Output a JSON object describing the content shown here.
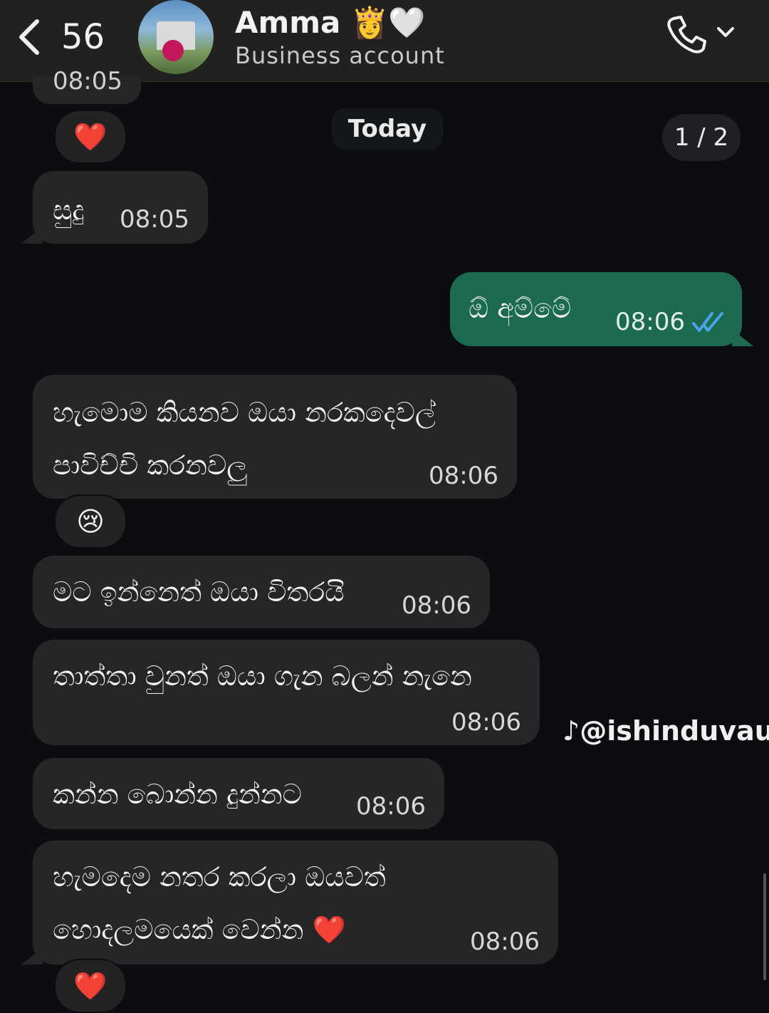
{
  "header": {
    "back_count": "56",
    "contact_name": "Amma",
    "name_emojis": "👸🤍",
    "subtitle": "Business account"
  },
  "chat": {
    "previous_time_partial": "08:05",
    "date_label": "Today",
    "page_indicator": "1 / 2",
    "messages": [
      {
        "text": "සුදු",
        "time": "08:05",
        "direction": "incoming"
      },
      {
        "text": "ඕ අම්මේ",
        "time": "08:06",
        "direction": "outgoing",
        "status": "read"
      },
      {
        "text": "හැමොම කියනව ඔයා නරකදෙවල්\nපාවිච්චි කරනවලු",
        "time": "08:06",
        "direction": "incoming",
        "reaction": "😢"
      },
      {
        "text": "මට ඉන්නෙත් ඔයා විතරයි",
        "time": "08:06",
        "direction": "incoming"
      },
      {
        "text": "තාත්තා වුනත් ඔයා ගැන බලන් නැනෙ",
        "time": "08:06",
        "direction": "incoming"
      },
      {
        "text": "කන්න බොන්න දුන්නට",
        "time": "08:06",
        "direction": "incoming"
      },
      {
        "text": "හැමදෙම නතර කරලා ඔයවත්\nහොදලමයෙක් වෙන්න ❤️",
        "time": "08:06",
        "direction": "incoming",
        "reaction": "❤️"
      }
    ],
    "top_reaction": "❤️"
  },
  "watermark": {
    "handle": "@ishinduvauu",
    "icon": "tiktok-note-icon"
  },
  "colors": {
    "incoming_bubble": "#262626",
    "outgoing_bubble": "#1d6b4e",
    "read_check": "#4aa3e8",
    "heart": "#e32424"
  }
}
